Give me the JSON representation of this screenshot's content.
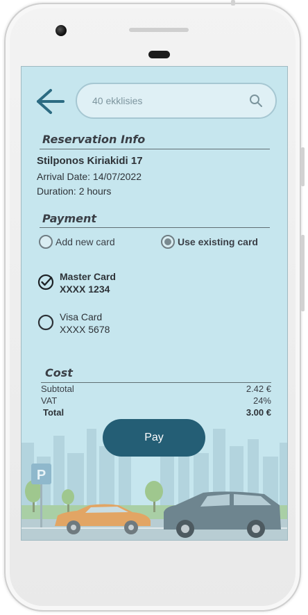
{
  "search": {
    "placeholder": "40 ekklisies"
  },
  "reservation": {
    "title": "Reservation Info",
    "address": "Stilponos Kiriakidi 17",
    "arrival": "Arrival Date: 14/07/2022",
    "duration": "Duration: 2 hours"
  },
  "payment": {
    "title": "Payment",
    "options": [
      {
        "label": "Add new card",
        "selected": false
      },
      {
        "label": "Use existing card",
        "selected": true
      }
    ],
    "cards": [
      {
        "name": "Master Card",
        "number": "XXXX 1234",
        "selected": true
      },
      {
        "name": "Visa Card",
        "number": "XXXX 5678",
        "selected": false
      }
    ]
  },
  "cost": {
    "title": "Cost",
    "rows": [
      {
        "label": "Subtotal",
        "value": "2.42 €"
      },
      {
        "label": "VAT",
        "value": "24%"
      },
      {
        "label": "Total",
        "value": "3.00 €"
      }
    ]
  },
  "pay_label": "Pay",
  "parking_sign": "P",
  "colors": {
    "accent": "#245e75",
    "screen_bg": "#c6e6ee"
  }
}
